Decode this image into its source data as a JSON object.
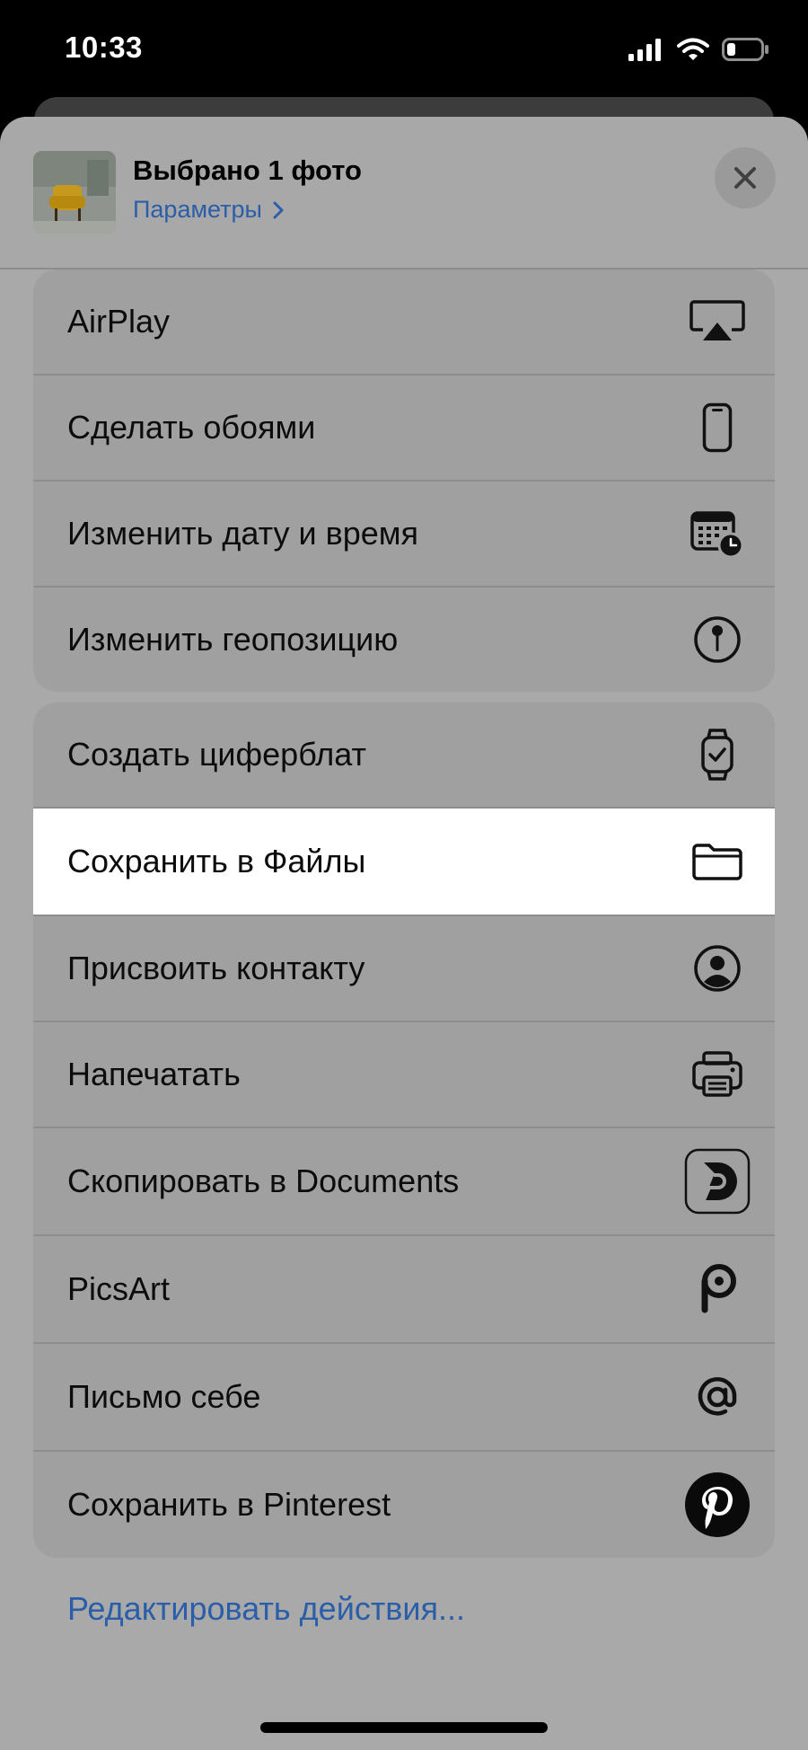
{
  "status_bar": {
    "time": "10:33"
  },
  "header": {
    "title": "Выбрано 1 фото",
    "options_link": "Параметры"
  },
  "group1": [
    {
      "label": "AirPlay",
      "icon": "airplay-icon"
    },
    {
      "label": "Сделать обоями",
      "icon": "phone-icon"
    },
    {
      "label": "Изменить дату и время",
      "icon": "calendar-clock-icon"
    },
    {
      "label": "Изменить геопозицию",
      "icon": "location-pin-icon"
    }
  ],
  "group2": [
    {
      "label": "Создать циферблат",
      "icon": "watch-icon"
    },
    {
      "label": "Сохранить в Файлы",
      "icon": "folder-icon",
      "highlighted": true
    },
    {
      "label": "Присвоить контакту",
      "icon": "contact-icon"
    },
    {
      "label": "Напечатать",
      "icon": "printer-icon"
    },
    {
      "label": "Скопировать в Documents",
      "icon": "documents-app-icon"
    },
    {
      "label": "PicsArt",
      "icon": "picsart-icon"
    },
    {
      "label": "Письмо себе",
      "icon": "at-sign-icon"
    },
    {
      "label": "Сохранить в Pinterest",
      "icon": "pinterest-icon"
    }
  ],
  "edit_actions": "Редактировать действия...",
  "colors": {
    "link": "#2a5ea8",
    "sheet": "#a9a9a9",
    "highlight": "#ffffff"
  }
}
